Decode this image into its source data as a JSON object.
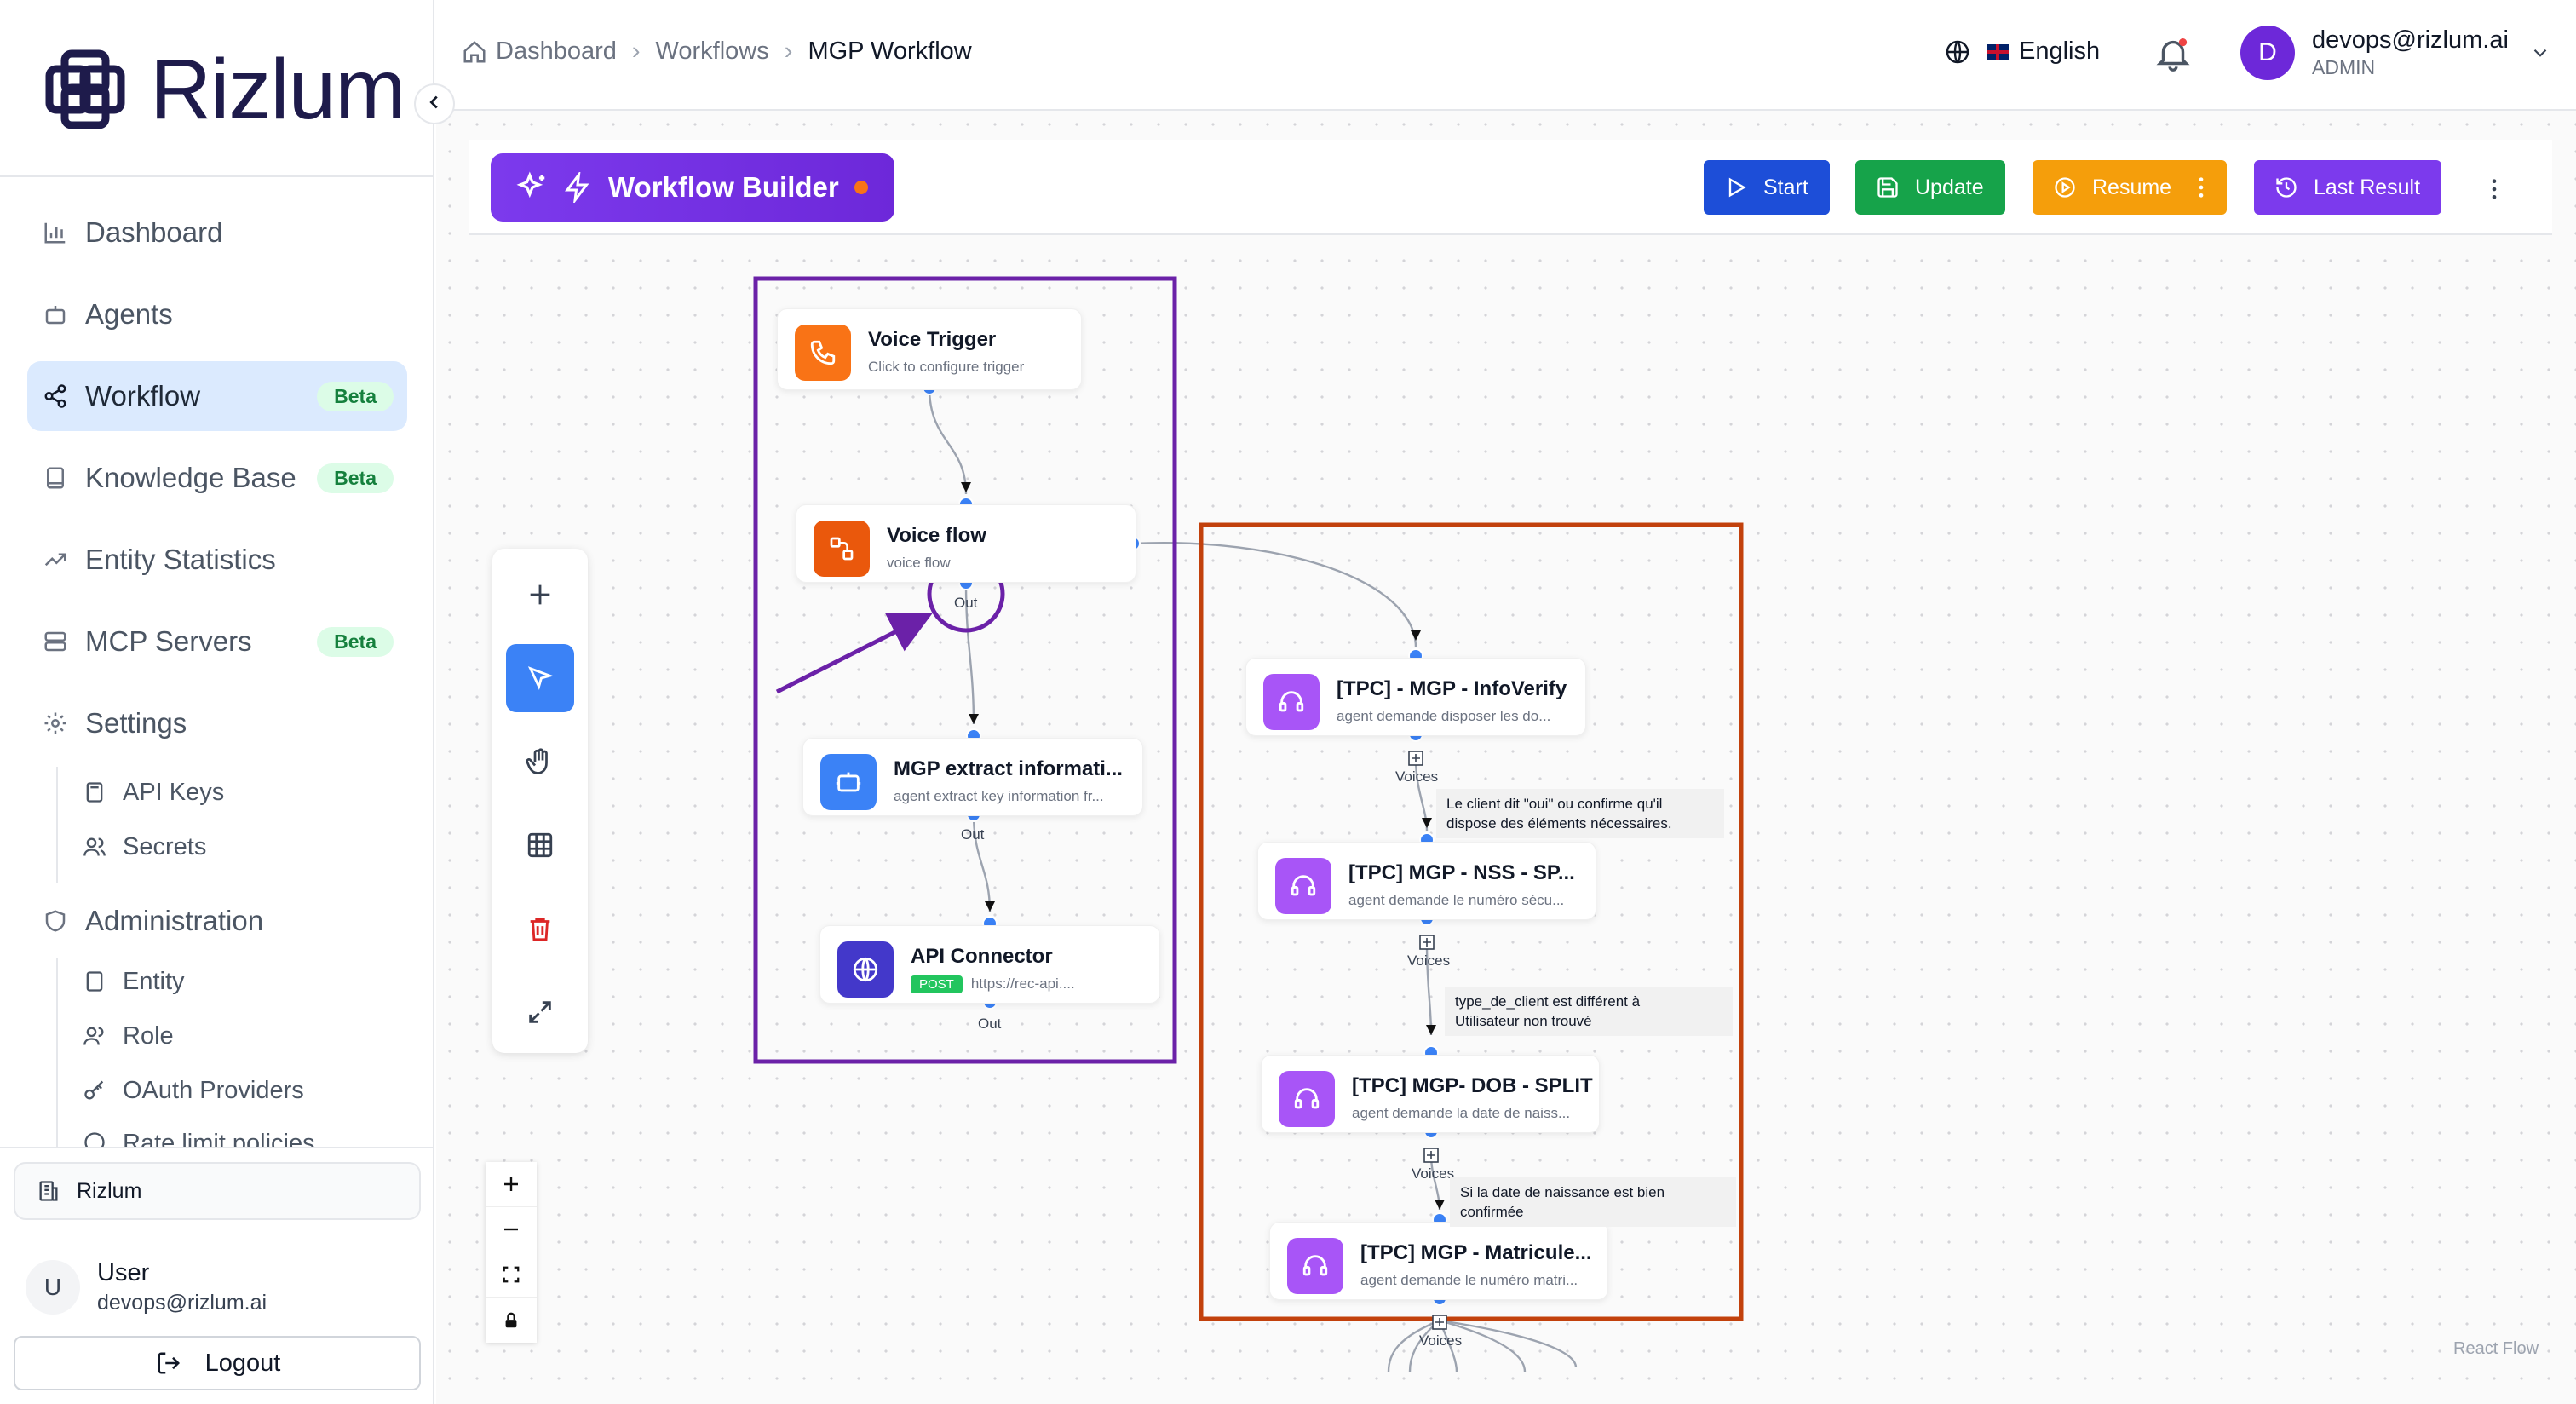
{
  "brand": {
    "name": "Rizlum"
  },
  "sidebar": {
    "items": [
      {
        "label": "Dashboard",
        "icon": "bar-chart-icon"
      },
      {
        "label": "Agents",
        "icon": "bot-icon"
      },
      {
        "label": "Workflow",
        "icon": "workflow-icon",
        "badge": "Beta",
        "active": true
      },
      {
        "label": "Knowledge Base",
        "icon": "book-icon",
        "badge": "Beta"
      },
      {
        "label": "Entity Statistics",
        "icon": "trending-up-icon"
      },
      {
        "label": "MCP Servers",
        "icon": "server-icon",
        "badge": "Beta"
      },
      {
        "label": "Settings",
        "icon": "gear-icon"
      }
    ],
    "settings_children": [
      "API Keys",
      "Secrets"
    ],
    "administration": "Administration",
    "admin_children": [
      "Entity",
      "Role",
      "OAuth Providers",
      "Rate limit policies"
    ],
    "org": "Rizlum",
    "user": {
      "initial": "U",
      "name": "User",
      "email": "devops@rizlum.ai"
    },
    "logout": "Logout"
  },
  "header": {
    "breadcrumbs": [
      "Dashboard",
      "Workflows",
      "MGP Workflow"
    ],
    "language": "English",
    "profile": {
      "initial": "D",
      "email": "devops@rizlum.ai",
      "role": "ADMIN"
    }
  },
  "toolbar": {
    "title": "Workflow Builder",
    "start": "Start",
    "update": "Update",
    "resume": "Resume",
    "last_result": "Last Result",
    "colors": {
      "start": "#1d4ed8",
      "update": "#16a34a",
      "resume": "#f59e0b",
      "last_result": "#7c3aed"
    }
  },
  "nodes": {
    "voice_trigger": {
      "title": "Voice Trigger",
      "subtitle": "Click to configure trigger"
    },
    "voice_flow": {
      "title": "Voice flow",
      "subtitle": "voice flow",
      "handle": "Out"
    },
    "mgp_extract": {
      "title": "MGP extract informati...",
      "subtitle": "agent extract key information fr...",
      "handle": "Out"
    },
    "api_connector": {
      "title": "API Connector",
      "method": "POST",
      "url": "https://rec-api....",
      "handle": "Out"
    },
    "info_verify": {
      "title": "[TPC] - MGP - InfoVerify",
      "subtitle": "agent demande disposer les do...",
      "handle": "Voices"
    },
    "nss": {
      "title": "[TPC] MGP - NSS - SP...",
      "subtitle": "agent demande le numéro sécu...",
      "handle": "Voices"
    },
    "dob": {
      "title": "[TPC] MGP- DOB - SPLIT",
      "subtitle": "agent demande la date de naiss...",
      "handle": "Voices"
    },
    "matricule": {
      "title": "[TPC] MGP - Matricule...",
      "subtitle": "agent demande le numéro matri...",
      "handle": "Voices"
    }
  },
  "edge_labels": {
    "e1": [
      "Le client dit \"oui\" ou confirme qu'il",
      "dispose des éléments nécessaires."
    ],
    "e2": [
      "type_de_client est différent à",
      "Utilisateur non trouvé"
    ],
    "e3": [
      "Si la date de naissance est bien",
      "confirmée"
    ]
  },
  "attribution": "React Flow"
}
